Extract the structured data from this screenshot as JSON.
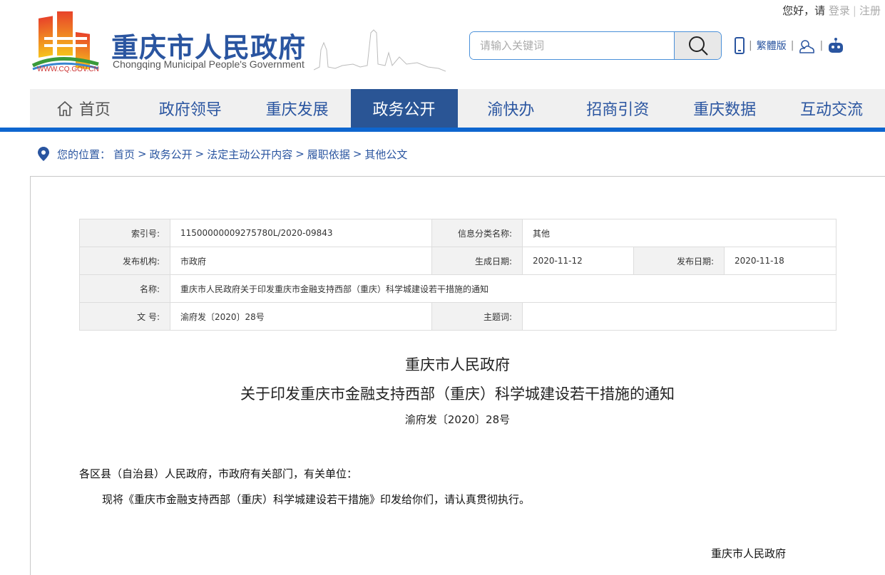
{
  "topbar": {
    "greeting": "您好，请",
    "login": "登录",
    "register": "注册"
  },
  "header": {
    "title": "重庆市人民政府",
    "subtitle": "Chongqing Municipal People's Government",
    "url": "WWW.CQ.GOV.CN"
  },
  "search": {
    "placeholder": "请输入关键词"
  },
  "tools": {
    "traditional": "繁體版"
  },
  "nav": {
    "items": [
      {
        "label": "首页"
      },
      {
        "label": "政府领导"
      },
      {
        "label": "重庆发展"
      },
      {
        "label": "政务公开"
      },
      {
        "label": "渝快办"
      },
      {
        "label": "招商引资"
      },
      {
        "label": "重庆数据"
      },
      {
        "label": "互动交流"
      }
    ],
    "active": "政务公开"
  },
  "breadcrumb": {
    "prefix": "您的位置：",
    "items": [
      "首页",
      "政务公开",
      "法定主动公开内容",
      "履职依据",
      "其他公文"
    ],
    "sep": ">"
  },
  "meta": {
    "index_label": "索引号:",
    "index": "11500000009275780L/2020-09843",
    "category_label": "信息分类名称:",
    "category": "其他",
    "org_label": "发布机构:",
    "org": "市政府",
    "created_label": "生成日期:",
    "created": "2020-11-12",
    "published_label": "发布日期:",
    "published": "2020-11-18",
    "name_label": "名称:",
    "name": "重庆市人民政府关于印发重庆市金融支持西部（重庆）科学城建设若干措施的通知",
    "docno_label": "文 号:",
    "docno": "渝府发〔2020〕28号",
    "keywords_label": "主题词:",
    "keywords": ""
  },
  "doc": {
    "title1": "重庆市人民政府",
    "title2": "关于印发重庆市金融支持西部（重庆）科学城建设若干措施的通知",
    "number": "渝府发〔2020〕28号",
    "salutation": "各区县（自治县）人民政府，市政府有关部门，有关单位：",
    "body": "现将《重庆市金融支持西部（重庆）科学城建设若干措施》印发给你们，请认真贯彻执行。",
    "signature": "重庆市人民政府"
  },
  "colors": {
    "brand": "#2a55a0",
    "active_nav": "#2a5595",
    "line": "#0e66cf"
  }
}
